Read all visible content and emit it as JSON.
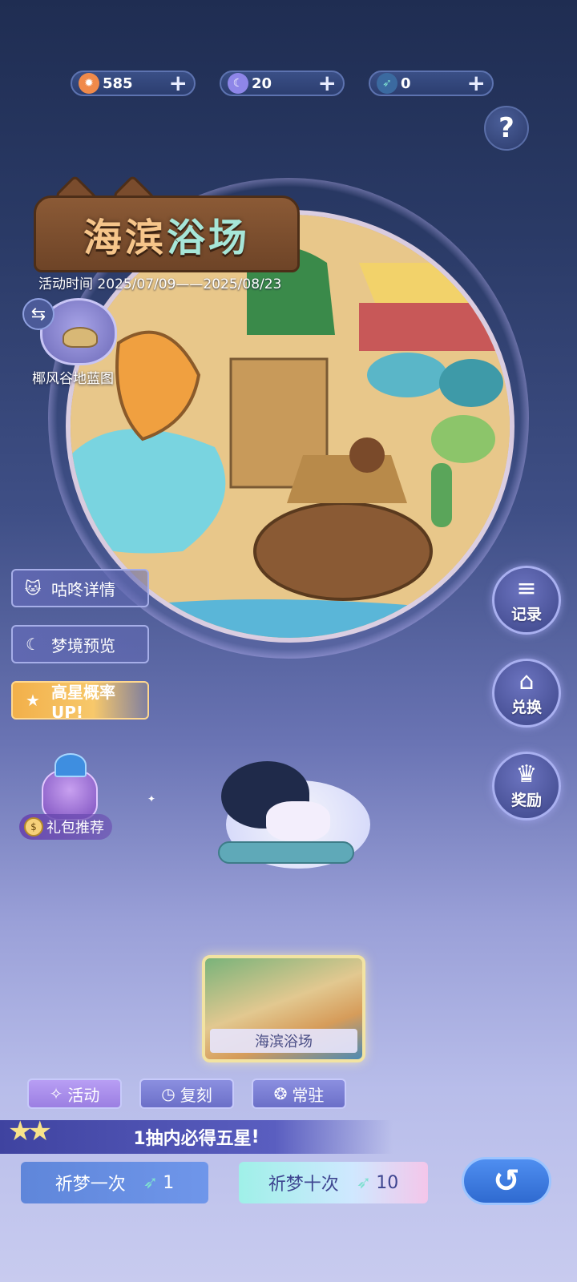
{
  "currencies": [
    {
      "name": "sun-coin",
      "value": "585",
      "color": "#f08a4a"
    },
    {
      "name": "moon-gem",
      "value": "20",
      "color": "#8e86e8"
    },
    {
      "name": "feather",
      "value": "0",
      "color": "#7fe0d0"
    }
  ],
  "plus_symbol": "+",
  "help_symbol": "?",
  "event": {
    "title_part1": "海滨",
    "title_part2": "浴场",
    "time": "活动时间 2025/07/09——2025/08/23"
  },
  "blueprint": {
    "label": "椰风谷地蓝图",
    "swap_symbol": "⇆"
  },
  "side_buttons": [
    {
      "label": "咕咚详情",
      "icon": "cat-icon"
    },
    {
      "label": "梦境预览",
      "icon": "moon-card-icon"
    },
    {
      "label": "高星概率UP!",
      "icon": "star-icon"
    }
  ],
  "gift": {
    "label": "礼包推荐",
    "coin_symbol": "$"
  },
  "right_buttons": [
    {
      "label": "记录",
      "icon": "fish-list-icon"
    },
    {
      "label": "兑换",
      "icon": "shop-icon"
    },
    {
      "label": "奖励",
      "icon": "reward-icon"
    }
  ],
  "pool_card": {
    "label": "海滨浴场"
  },
  "tabs": [
    {
      "label": "活动",
      "icon": "sparkle-hand-icon",
      "active": true
    },
    {
      "label": "复刻",
      "icon": "clock-icon",
      "active": false
    },
    {
      "label": "常驻",
      "icon": "swirl-icon",
      "active": false
    }
  ],
  "guarantee": {
    "prefix": "1抽内必得",
    "highlight": "五星",
    "suffix": "!"
  },
  "draw": {
    "one": {
      "label": "祈梦一次",
      "count": "1"
    },
    "ten": {
      "label": "祈梦十次",
      "count": "10"
    }
  },
  "back_symbol": "↺"
}
